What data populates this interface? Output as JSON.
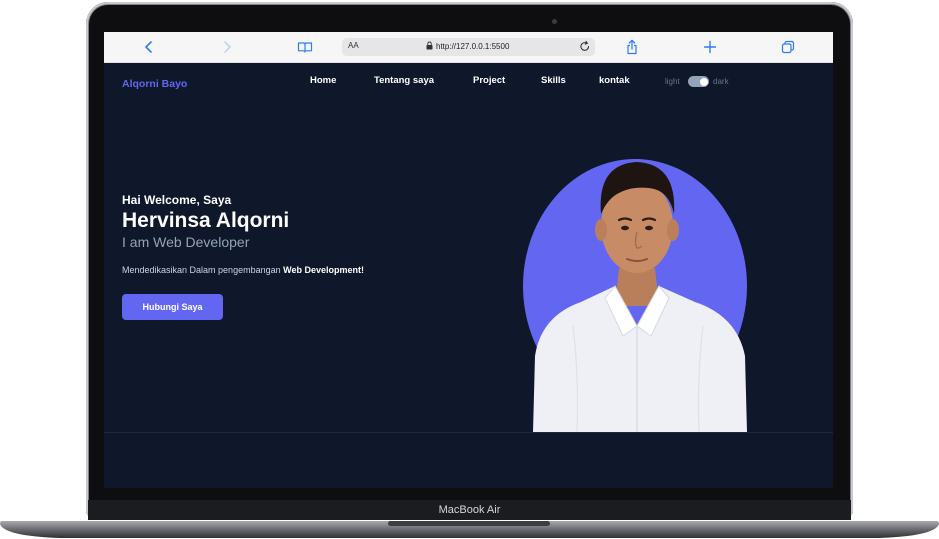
{
  "device": {
    "model_label": "MacBook Air"
  },
  "browser": {
    "text_size_label": "AA",
    "url": "http://127.0.0.1:5500",
    "icons": [
      "chevron-left-icon",
      "chevron-right-icon",
      "book-icon",
      "lock-icon",
      "reload-icon",
      "share-icon",
      "plus-icon",
      "tabs-icon"
    ]
  },
  "site": {
    "brand": "Alqorni Bayo",
    "nav": [
      "Home",
      "Tentang saya",
      "Project",
      "Skills",
      "kontak"
    ],
    "theme_toggle": {
      "light_label": "light",
      "dark_label": "dark",
      "state": "dark"
    },
    "hero": {
      "greeting": "Hai Welcome, Saya",
      "name": "Hervinsa Alqorni",
      "role": "I am Web Developer",
      "description_prefix": "Mendedikasikan Dalam pengembangan",
      "description_highlight": "Web Development!",
      "cta": "Hubungi Saya"
    },
    "colors": {
      "accent": "#6366f1",
      "background": "#0f172a",
      "text": "#ffffff",
      "muted": "#94a3b8"
    }
  }
}
